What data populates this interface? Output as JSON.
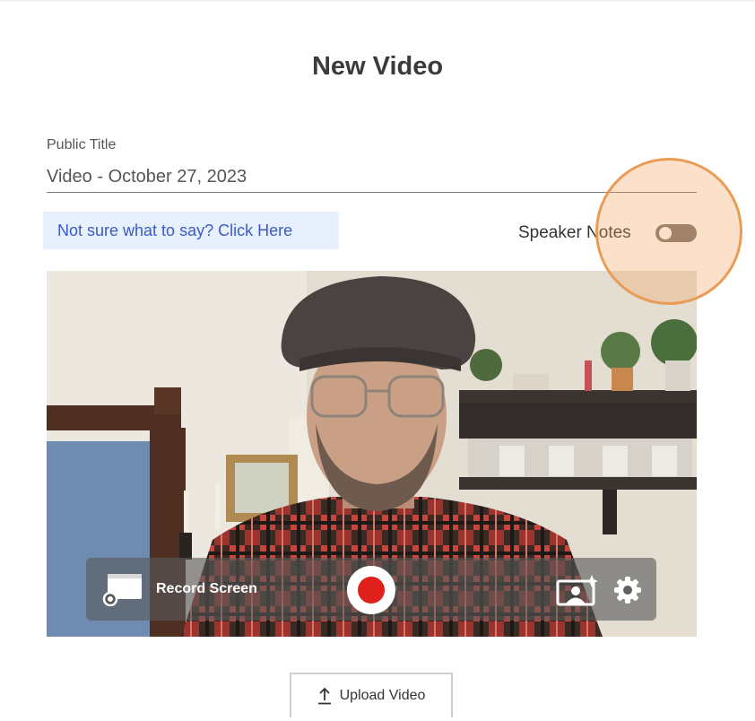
{
  "page": {
    "title": "New Video"
  },
  "title_field": {
    "label": "Public Title",
    "value": "Video - October 27, 2023"
  },
  "help_link": {
    "label": "Not sure what to say?  Click Here"
  },
  "speaker_notes": {
    "label": "Speaker Notes",
    "enabled": false
  },
  "video_controls": {
    "record_screen_label": "Record Screen",
    "record_icon": "record-icon",
    "effects_icon": "portrait-sparkle-icon",
    "settings_icon": "gear-icon"
  },
  "upload": {
    "label": "Upload Video",
    "icon": "upload-arrow-icon"
  },
  "colors": {
    "link": "#3b5bc9",
    "link_background": "#e7f0fc",
    "record": "#e0201a",
    "highlight": "#ea9b54",
    "toggle_off": "#7b7370"
  }
}
